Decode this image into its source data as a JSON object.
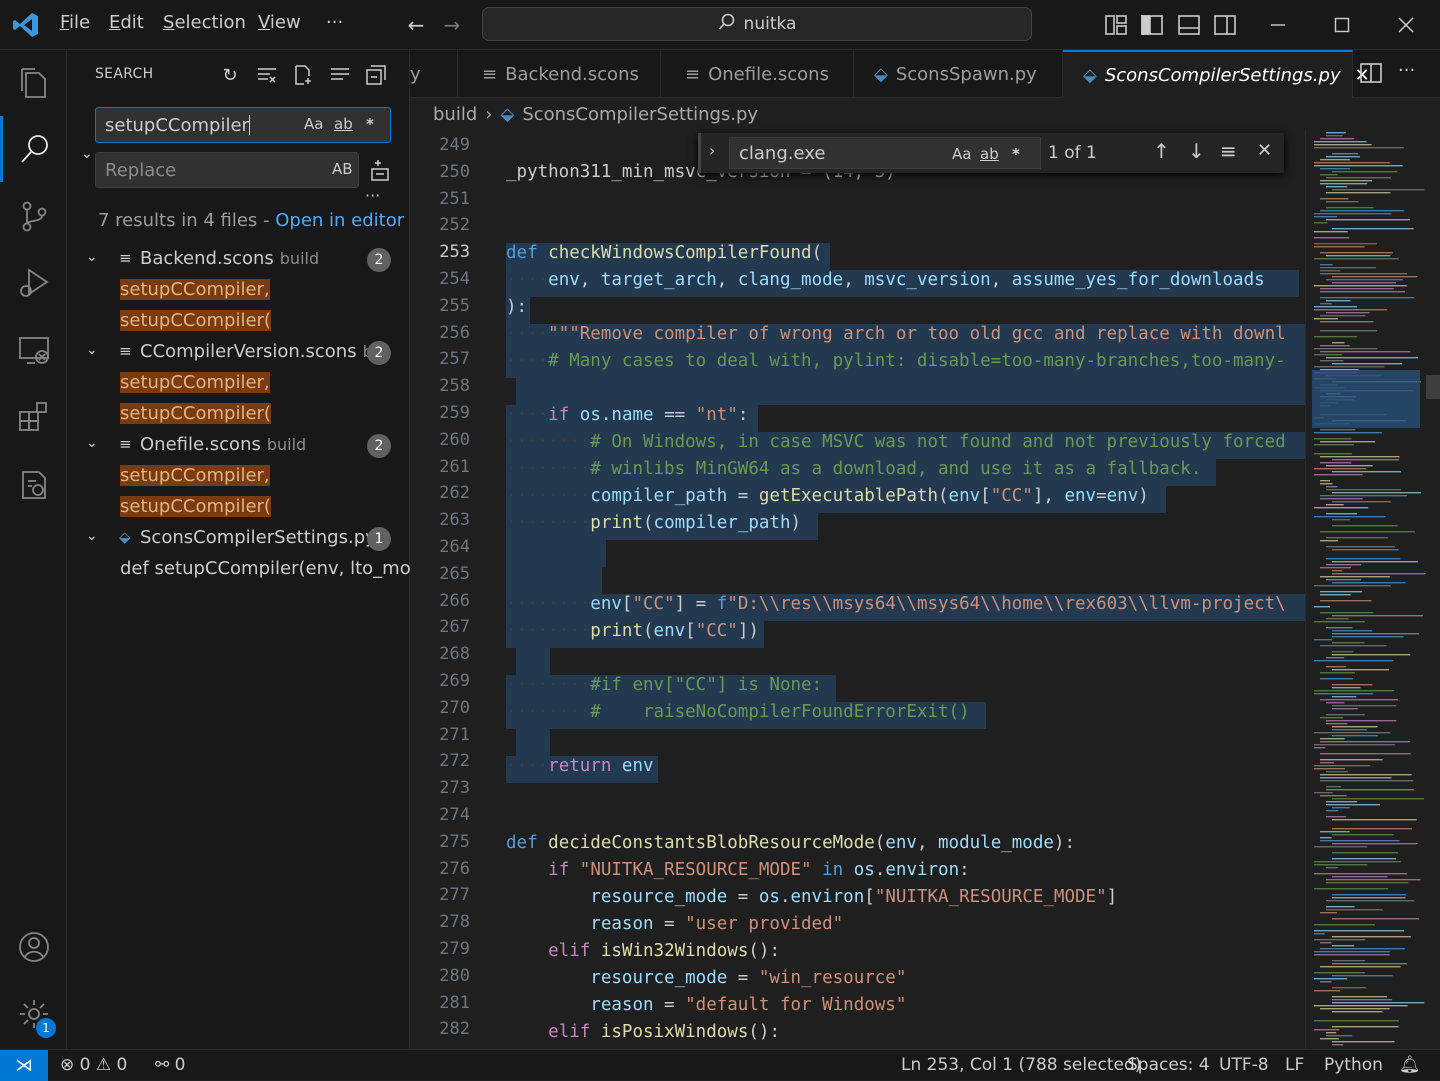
{
  "titlebar": {
    "menus": [
      "File",
      "Edit",
      "Selection",
      "View",
      "···"
    ],
    "command_center": "nuitka"
  },
  "sidebar": {
    "title": "SEARCH",
    "search_value": "setupCCompiler",
    "replace_placeholder": "Replace",
    "search_opts": [
      "Aa",
      "ab",
      "*"
    ],
    "replace_opt": "AB",
    "more": "···",
    "results_text": "7 results in 4 files - ",
    "results_link": "Open in editor",
    "files": [
      {
        "name": "Backend.scons",
        "dir": "build",
        "count": "2",
        "icon": "list-icon",
        "matches": [
          "setupCCompiler,",
          "setupCCompiler("
        ]
      },
      {
        "name": "CCompilerVersion.scons",
        "dir": "b...",
        "count": "2",
        "icon": "list-icon",
        "matches": [
          "setupCCompiler,",
          "setupCCompiler("
        ]
      },
      {
        "name": "Onefile.scons",
        "dir": "build",
        "count": "2",
        "icon": "list-icon",
        "matches": [
          "setupCCompiler,",
          "setupCCompiler("
        ]
      },
      {
        "name": "SconsCompilerSettings.py...",
        "dir": "",
        "count": "1",
        "icon": "python-icon",
        "matches": [
          "def setupCCompiler(env, lto_mod..."
        ]
      }
    ]
  },
  "tabs": [
    {
      "label": "y",
      "icon": ""
    },
    {
      "label": "Backend.scons",
      "icon": "list-icon"
    },
    {
      "label": "Onefile.scons",
      "icon": "list-icon"
    },
    {
      "label": "SconsSpawn.py",
      "icon": "python-icon"
    },
    {
      "label": "SconsCompilerSettings.py",
      "icon": "python-icon",
      "active": true
    }
  ],
  "breadcrumbs": [
    "build",
    "SconsCompilerSettings.py"
  ],
  "find": {
    "value": "clang.exe",
    "opts": [
      "Aa",
      "ab",
      "*"
    ],
    "count": "1 of 1"
  },
  "line_numbers": [
    "249",
    "250",
    "251",
    "252",
    "253",
    "254",
    "255",
    "256",
    "257",
    "258",
    "259",
    "260",
    "261",
    "262",
    "263",
    "264",
    "265",
    "266",
    "267",
    "268",
    "269",
    "270",
    "271",
    "272",
    "273",
    "274",
    "275",
    "276",
    "277",
    "278",
    "279",
    "280",
    "281",
    "282"
  ],
  "status": {
    "errors": "0",
    "warnings": "0",
    "ports": "0",
    "position": "Ln 253, Col 1 (788 selected)",
    "spaces": "Spaces: 4",
    "encoding": "UTF-8",
    "eol": "LF",
    "language": "Python",
    "settings_badge": "1"
  },
  "colors": {
    "accent": "#0078d4",
    "match_bg": "#7a3a12",
    "selection": "#264f78"
  }
}
